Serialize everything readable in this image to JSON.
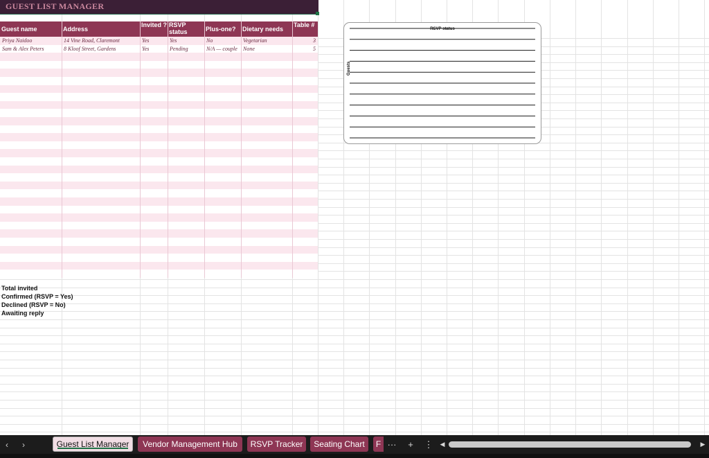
{
  "sheet": {
    "title": "GUEST LIST MANAGER",
    "columns": [
      "Guest name",
      "Address",
      "Invited ?",
      "RSVP status",
      "Plus-one?",
      "Dietary needs",
      "Table #"
    ],
    "rows": [
      [
        "Priya Naidoo",
        "14 Vine Road, Claremont",
        "Yes",
        "Yes",
        "No",
        "Vegetarian",
        "3"
      ],
      [
        "Sam & Alex Peters",
        "8 Kloof Street, Gardens",
        "Yes",
        "Pending",
        "N/A — couple",
        "None",
        "5"
      ]
    ],
    "summary": [
      "Total invited",
      "Confirmed (RSVP = Yes)",
      "Declined (RSVP = No)",
      "Awaiting reply"
    ]
  },
  "chart": {
    "title": "RSVP status",
    "ylabel": "Guests"
  },
  "tabs": {
    "prev": "‹",
    "next": "›",
    "items": [
      {
        "label": "Guest List Manager",
        "active": true
      },
      {
        "label": "Vendor Management Hub",
        "active": false
      },
      {
        "label": "RSVP Tracker",
        "active": false
      },
      {
        "label": "Seating Chart",
        "active": false
      },
      {
        "label": "F",
        "active": false
      }
    ],
    "more": "···",
    "add": "+",
    "options": "⋮",
    "scroll_left": "◀",
    "scroll_right": "▶"
  },
  "colors": {
    "banner": "#3b1f36",
    "header": "#8e3654",
    "band": "#fbe7ee",
    "accent": "#1e7145"
  }
}
